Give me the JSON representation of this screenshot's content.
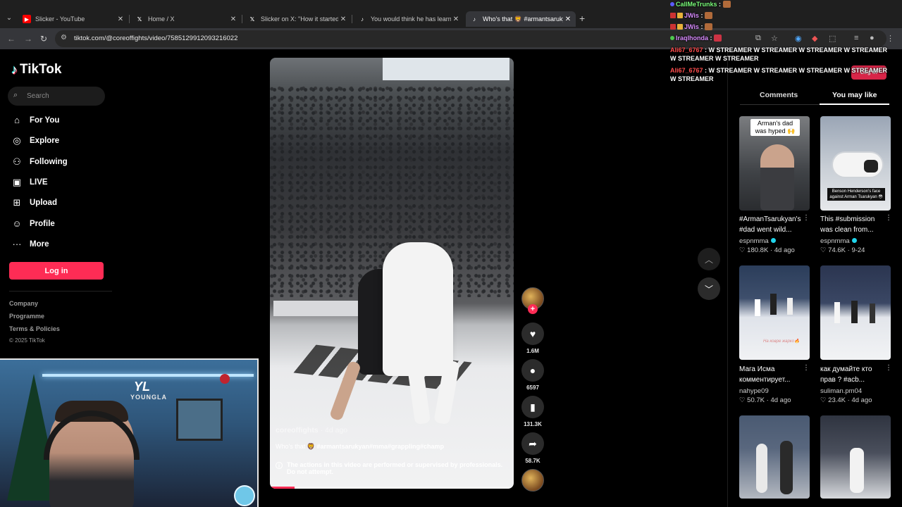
{
  "browser": {
    "tabs": [
      {
        "title": "Slicker - YouTube",
        "favicon": "youtube-icon",
        "active": false
      },
      {
        "title": "Home / X",
        "favicon": "x-icon",
        "active": false
      },
      {
        "title": "Slicker on X: \"How it started vs h",
        "favicon": "x-icon",
        "active": false
      },
      {
        "title": "You would think he has learned",
        "favicon": "tiktok-icon",
        "active": false
      },
      {
        "title": "Who's that 🦁 #armantsarukya",
        "favicon": "tiktok-icon",
        "active": true
      }
    ],
    "url": "tiktok.com/@coreoffights/video/7585129912093216022"
  },
  "sidebar": {
    "logo": "TikTok",
    "search_placeholder": "Search",
    "nav": [
      {
        "label": "For You",
        "icon": "home-icon"
      },
      {
        "label": "Explore",
        "icon": "compass-icon"
      },
      {
        "label": "Following",
        "icon": "following-icon"
      },
      {
        "label": "LIVE",
        "icon": "live-icon"
      },
      {
        "label": "Upload",
        "icon": "upload-icon"
      },
      {
        "label": "Profile",
        "icon": "profile-icon"
      },
      {
        "label": "More",
        "icon": "more-icon"
      }
    ],
    "login": "Log in",
    "footer": [
      "Company",
      "Programme",
      "Terms & Policies"
    ],
    "copyright": "© 2025 TikTok"
  },
  "video": {
    "author": "coreoffights",
    "date": "· 4d ago",
    "caption_prefix": "Who's that 🦁 ",
    "caption_tags": "#armantsarukyan#mma#grappling#champ",
    "notice": "The actions in this video are performed or supervised by professionals. Do not attempt.",
    "progress": 0.1,
    "likes": "1.6M",
    "comments": "6597",
    "saves": "131.3K",
    "shares": "58.7K"
  },
  "right_panel": {
    "tabs": [
      "Comments",
      "You may like"
    ],
    "active_tab": "You may like",
    "cards": [
      {
        "title": "#ArmanTsarukyan's #dad went wild...",
        "author": "espnmma",
        "verified": true,
        "likes": "180.8K",
        "age": "4d ago",
        "overlay": "Arman's dad was hyped 🙌"
      },
      {
        "title": "This #submission was clean from...",
        "author": "espnmma",
        "verified": true,
        "likes": "74.6K",
        "age": "9-24",
        "overlay": "Benson Henderson's face against Arman Tsarukyan 😳"
      },
      {
        "title": "Мага Исма комментирует...",
        "author": "nahype09",
        "verified": false,
        "likes": "50.7K",
        "age": "4d ago",
        "overlay": "На ковре жарко🔥"
      },
      {
        "title": "как думайте кто прав ? #acb...",
        "author": "suliman.pm04",
        "verified": false,
        "likes": "23.4K",
        "age": "4d ago",
        "overlay": ""
      }
    ]
  },
  "chat": [
    {
      "user": "CallMeTrunks",
      "color": "#7cff7c",
      "text": ""
    },
    {
      "user": "JWis",
      "color": "#d98cff",
      "text": ""
    },
    {
      "user": "JWis",
      "color": "#d98cff",
      "text": ""
    },
    {
      "user": "Iraqlhonda",
      "color": "#d98cff",
      "text": ""
    },
    {
      "user": "Ali67_6767",
      "color": "#ff4d4d",
      "text": "W STREAMER W STREAMER W STREAMER W STREAMER W STREAMER W STREAMER"
    },
    {
      "user": "Ali67_6767",
      "color": "#ff4d4d",
      "text": "W STREAMER W STREAMER W STREAMER W STREAMER W STREAMER"
    }
  ],
  "header_login": "Log in",
  "webcam": {
    "brand": "YOUNGLA"
  }
}
